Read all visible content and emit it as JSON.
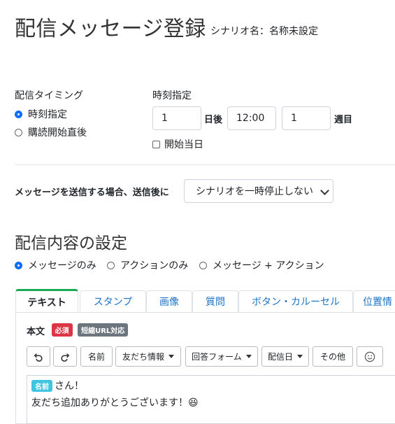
{
  "page": {
    "title": "配信メッセージ登録",
    "scenario_label": "シナリオ名：名称未設定"
  },
  "timing": {
    "label": "配信タイミング",
    "options": [
      {
        "label": "時刻指定",
        "selected": true
      },
      {
        "label": "購読開始直後",
        "selected": false
      }
    ]
  },
  "time_spec": {
    "label": "時刻指定",
    "days_value": "1",
    "days_suffix": "日後",
    "time_value": "12:00",
    "weeks_value": "1",
    "weeks_suffix": "週目",
    "start_day_label": "開始当日",
    "start_day_checked": false
  },
  "after_send": {
    "label": "メッセージを送信する場合、送信後に",
    "selected": "シナリオを一時停止しない"
  },
  "content": {
    "heading": "配信内容の設定",
    "types": [
      {
        "label": "メッセージのみ",
        "selected": true
      },
      {
        "label": "アクションのみ",
        "selected": false
      },
      {
        "label": "メッセージ + アクション",
        "selected": false
      }
    ]
  },
  "tabs": [
    "テキスト",
    "スタンプ",
    "画像",
    "質問",
    "ボタン・カルーセル",
    "位置情"
  ],
  "body": {
    "label": "本文",
    "required_badge": "必須",
    "url_badge": "短縮URL対応",
    "required_color": "#dc3545",
    "url_color": "#6c757d"
  },
  "toolbar": {
    "undo_icon": "undo-icon",
    "redo_icon": "redo-icon",
    "name": "名前",
    "friend_info": "友だち情報",
    "answer_form": "回答フォーム",
    "delivery_date": "配信日",
    "other": "その他",
    "emoji_icon": "smiley-icon"
  },
  "editor": {
    "name_tag": "名前",
    "line1_suffix": "さん！",
    "line2": "友だち追加ありがとうございます！😆"
  },
  "colors": {
    "accent": "#0d6efd",
    "tab_active_border": "#1aaa55",
    "link": "#1a73c8"
  }
}
